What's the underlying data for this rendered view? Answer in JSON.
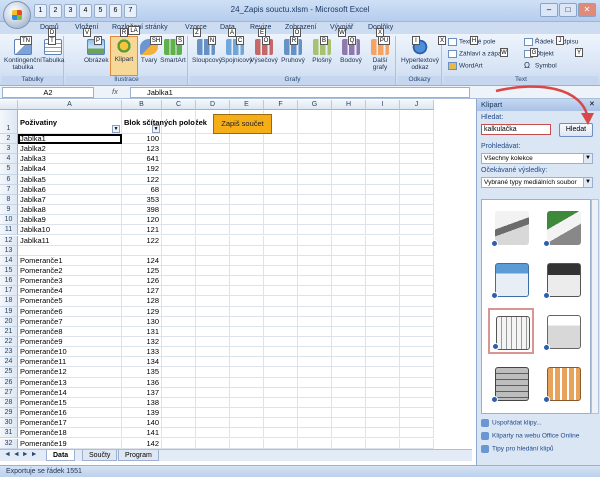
{
  "window": {
    "title": "24_Zapis souctu.xlsm - Microsoft Excel",
    "minimize": "–",
    "maximize": "□",
    "close": "✕"
  },
  "qat": [
    "1",
    "2",
    "3",
    "4",
    "5",
    "6",
    "7"
  ],
  "tabs": [
    {
      "label": "Domů",
      "key": "D"
    },
    {
      "label": "Vložení",
      "key": "V"
    },
    {
      "label": "Rozložení stránky",
      "key": "R"
    },
    {
      "label": "Vzorce",
      "key": "Z"
    },
    {
      "label": "Data",
      "key": "A"
    },
    {
      "label": "Revize",
      "key": "E"
    },
    {
      "label": "Zobrazení",
      "key": "O"
    },
    {
      "label": "Vývojář",
      "key": "W"
    },
    {
      "label": "Doplňky",
      "key": "X"
    }
  ],
  "ribbon": {
    "tabulky": {
      "label": "Tabulky",
      "kontingencni": "Kontingenční tabulka",
      "tabulka": "Tabulka"
    },
    "ilustrace": {
      "label": "Ilustrace",
      "obrazek": "Obrázek",
      "klipart": "Klipart",
      "tvary": "Tvary",
      "smartart": "SmartArt"
    },
    "grafy": {
      "label": "Grafy",
      "items": [
        "Sloupcový",
        "Spojnicový",
        "Výsečový",
        "Pruhový",
        "Plošný",
        "Bodový",
        "Další grafy"
      ]
    },
    "odkazy": {
      "label": "Odkazy",
      "hypertext": "Hypertextový odkaz"
    },
    "text": {
      "label": "Text",
      "textove_pole": "Textové pole",
      "zahlavi": "Záhlaví a zápatí",
      "wordart": "WordArt",
      "radek_podpisu": "Řádek podpisu",
      "objekt": "Objekt",
      "symbol": "Symbol"
    },
    "keytips": [
      "TN",
      "T",
      "P",
      "LA",
      "SH",
      "S",
      "N",
      "C",
      "O",
      "R",
      "B",
      "Q",
      "PU",
      "I",
      "X",
      "H",
      "W",
      "G",
      "J",
      "Y"
    ]
  },
  "formula": {
    "namebox": "A2",
    "value": "Jablka1",
    "fx": "fx"
  },
  "columns": [
    "A",
    "B",
    "C",
    "D",
    "E",
    "F",
    "G",
    "H",
    "I",
    "J"
  ],
  "headers": {
    "a": "Poživatiny",
    "b": "Blok sčítaných položek"
  },
  "sum_button": "Zapiš součet",
  "rows": [
    {
      "n": "2",
      "a": "Jablka1",
      "b": "100"
    },
    {
      "n": "3",
      "a": "Jablka2",
      "b": "123"
    },
    {
      "n": "4",
      "a": "Jablka3",
      "b": "641"
    },
    {
      "n": "5",
      "a": "Jablka4",
      "b": "192"
    },
    {
      "n": "6",
      "a": "Jablka5",
      "b": "122"
    },
    {
      "n": "7",
      "a": "Jablka6",
      "b": "68"
    },
    {
      "n": "8",
      "a": "Jablka7",
      "b": "353"
    },
    {
      "n": "9",
      "a": "Jablka8",
      "b": "398"
    },
    {
      "n": "10",
      "a": "Jablka9",
      "b": "120"
    },
    {
      "n": "11",
      "a": "Jablka10",
      "b": "121"
    },
    {
      "n": "12",
      "a": "Jablka11",
      "b": "122"
    },
    {
      "n": "13",
      "a": "",
      "b": ""
    },
    {
      "n": "14",
      "a": "Pomeranče1",
      "b": "124"
    },
    {
      "n": "15",
      "a": "Pomeranče2",
      "b": "125"
    },
    {
      "n": "16",
      "a": "Pomeranče3",
      "b": "126"
    },
    {
      "n": "17",
      "a": "Pomeranče4",
      "b": "127"
    },
    {
      "n": "18",
      "a": "Pomeranče5",
      "b": "128"
    },
    {
      "n": "19",
      "a": "Pomeranče6",
      "b": "129"
    },
    {
      "n": "20",
      "a": "Pomeranče7",
      "b": "130"
    },
    {
      "n": "21",
      "a": "Pomeranče8",
      "b": "131"
    },
    {
      "n": "22",
      "a": "Pomeranče9",
      "b": "132"
    },
    {
      "n": "23",
      "a": "Pomeranče10",
      "b": "133"
    },
    {
      "n": "24",
      "a": "Pomeranče11",
      "b": "134"
    },
    {
      "n": "25",
      "a": "Pomeranče12",
      "b": "135"
    },
    {
      "n": "26",
      "a": "Pomeranče13",
      "b": "136"
    },
    {
      "n": "27",
      "a": "Pomeranče14",
      "b": "137"
    },
    {
      "n": "28",
      "a": "Pomeranče15",
      "b": "138"
    },
    {
      "n": "29",
      "a": "Pomeranče16",
      "b": "139"
    },
    {
      "n": "30",
      "a": "Pomeranče17",
      "b": "140"
    },
    {
      "n": "31",
      "a": "Pomeranče18",
      "b": "141"
    },
    {
      "n": "32",
      "a": "Pomeranče19",
      "b": "142"
    }
  ],
  "sheet_tabs": [
    "Data",
    "Součty",
    "Program"
  ],
  "status": "Exportuje se řádek 1551",
  "taskpane": {
    "title": "Klipart",
    "close": "✕",
    "search_label": "Hledat:",
    "search_value": "kalkulačka",
    "search_button": "Hledat",
    "scope_label": "Prohledávat:",
    "scope_value": "Všechny kolekce",
    "results_label": "Očekávané výsledky:",
    "results_value": "Vybrané typy mediálních soubor",
    "links": [
      "Uspořádat klipy...",
      "Kliparty na webu Office Online",
      "Tipy pro hledání klipů"
    ]
  },
  "colors": {
    "accent": "#f5ad18",
    "highlight": "#d94848",
    "ribbon": "#d7e4f5"
  }
}
